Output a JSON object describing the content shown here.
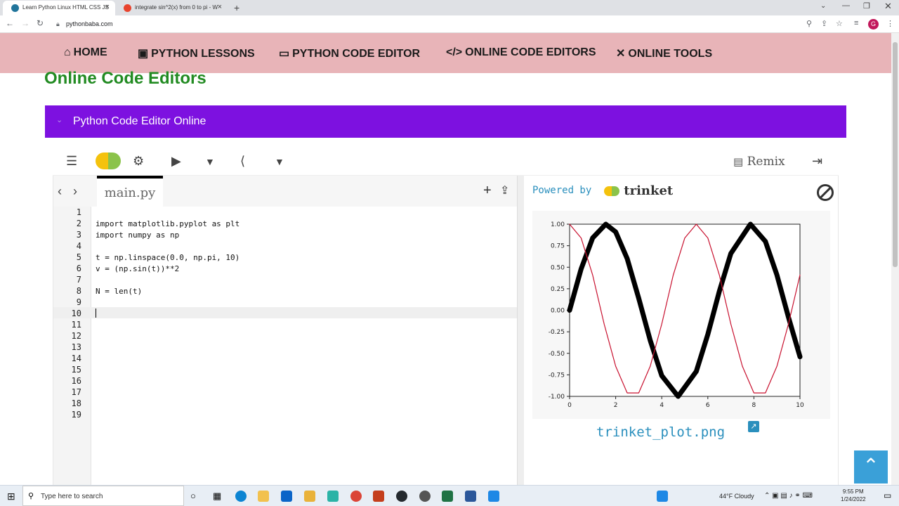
{
  "browser": {
    "tabs": [
      {
        "title": "Learn Python Linux HTML CSS JS",
        "active": true
      },
      {
        "title": "integrate sin^2(x) from 0 to pi - W",
        "active": false
      }
    ],
    "url": "pythonbaba.com",
    "profile_initial": "G"
  },
  "site_nav": {
    "items": [
      {
        "label": "HOME",
        "icon": "home-icon"
      },
      {
        "label": "PYTHON LESSONS",
        "icon": "book-icon"
      },
      {
        "label": "PYTHON CODE EDITOR",
        "icon": "monitor-icon"
      },
      {
        "label": "ONLINE CODE EDITORS",
        "icon": "code-icon"
      },
      {
        "label": "ONLINE TOOLS",
        "icon": "tools-icon"
      }
    ]
  },
  "page": {
    "heading": "Online Code Editors",
    "accordion_title": "Python Code Editor Online"
  },
  "trinket": {
    "remix_label": "Remix",
    "file_tab": "main.py",
    "powered_by": "Powered by",
    "brand": "trinket",
    "plot_filename": "trinket_plot.png",
    "code_lines": [
      "",
      "import matplotlib.pyplot as plt",
      "import numpy as np",
      "",
      "t = np.linspace(0.0, np.pi, 10)",
      "v = (np.sin(t))**2",
      "",
      "N = len(t)",
      "",
      "",
      "",
      "",
      "",
      "",
      "",
      "",
      "",
      "",
      ""
    ],
    "line_numbers": [
      "1",
      "2",
      "3",
      "4",
      "5",
      "6",
      "7",
      "8",
      "9",
      "10",
      "11",
      "12",
      "13",
      "14",
      "15",
      "16",
      "17",
      "18",
      "19"
    ]
  },
  "chart_data": {
    "type": "line",
    "xlim": [
      0,
      10
    ],
    "ylim": [
      -1.0,
      1.0
    ],
    "xticks": [
      "0",
      "2",
      "4",
      "6",
      "8",
      "10"
    ],
    "yticks": [
      "1.00",
      "0.75",
      "0.50",
      "0.25",
      "0.00",
      "-0.25",
      "-0.50",
      "-0.75",
      "-1.00"
    ],
    "series": [
      {
        "color": "#000000",
        "line_width": "thick",
        "x": [
          0.0,
          0.5,
          1.0,
          1.57,
          2.0,
          2.5,
          3.0,
          3.5,
          4.0,
          4.71,
          5.5,
          6.0,
          6.5,
          7.0,
          7.85,
          8.5,
          9.0,
          9.5,
          10.0
        ],
        "y": [
          0.0,
          0.48,
          0.84,
          1.0,
          0.91,
          0.6,
          0.14,
          -0.35,
          -0.76,
          -1.0,
          -0.71,
          -0.28,
          0.22,
          0.66,
          1.0,
          0.8,
          0.41,
          -0.08,
          -0.54
        ]
      },
      {
        "color": "#c8102e",
        "line_width": "thin",
        "x": [
          0.0,
          0.5,
          1.0,
          1.5,
          2.0,
          2.5,
          3.0,
          3.5,
          4.0,
          4.5,
          5.0,
          5.5,
          6.0,
          6.5,
          7.0,
          7.5,
          8.0,
          8.5,
          9.0,
          9.5,
          10.0
        ],
        "y": [
          1.0,
          0.84,
          0.41,
          -0.16,
          -0.65,
          -0.96,
          -0.96,
          -0.65,
          -0.16,
          0.41,
          0.84,
          1.0,
          0.84,
          0.41,
          -0.16,
          -0.65,
          -0.96,
          -0.96,
          -0.65,
          -0.16,
          0.41
        ]
      }
    ]
  },
  "taskbar": {
    "search_placeholder": "Type here to search",
    "weather": "44°F Cloudy",
    "time": "9:55 PM",
    "date": "1/24/2022"
  }
}
